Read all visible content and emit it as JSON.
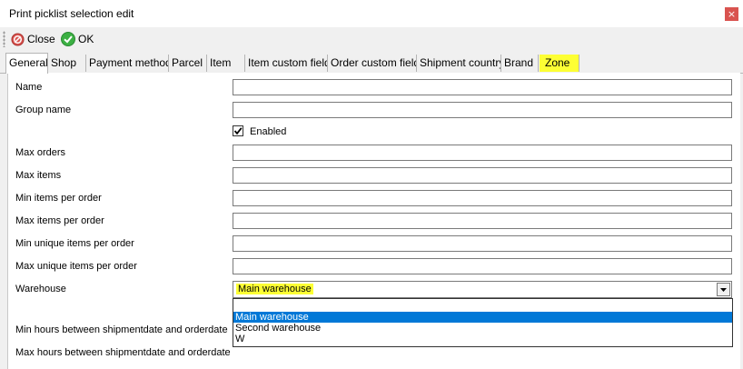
{
  "window": {
    "title": "Print picklist selection edit",
    "close_glyph": "×"
  },
  "toolbar": {
    "close_label": "Close",
    "ok_label": "OK"
  },
  "tabs": [
    {
      "id": "general",
      "label": "General",
      "active": true
    },
    {
      "id": "shop",
      "label": "Shop"
    },
    {
      "id": "payment-method",
      "label": "Payment method"
    },
    {
      "id": "parcel",
      "label": "Parcel"
    },
    {
      "id": "item",
      "label": "Item"
    },
    {
      "id": "item-custom-field",
      "label": "Item custom field"
    },
    {
      "id": "order-custom-field",
      "label": "Order custom field"
    },
    {
      "id": "shipment-country",
      "label": "Shipment country"
    },
    {
      "id": "brand",
      "label": "Brand"
    },
    {
      "id": "zone",
      "label": "Zone",
      "highlighted": true
    }
  ],
  "form": {
    "name_label": "Name",
    "name_value": "",
    "group_name_label": "Group name",
    "group_name_value": "",
    "enabled_label": "Enabled",
    "enabled_checked": true,
    "max_orders_label": "Max orders",
    "max_orders_value": "",
    "max_items_label": "Max items",
    "max_items_value": "",
    "min_items_per_order_label": "Min items per order",
    "min_items_per_order_value": "",
    "max_items_per_order_label": "Max items per order",
    "max_items_per_order_value": "",
    "min_unique_items_per_order_label": "Min unique items per order",
    "min_unique_items_per_order_value": "",
    "max_unique_items_per_order_label": "Max unique items per order",
    "max_unique_items_per_order_value": "",
    "warehouse_label": "Warehouse",
    "warehouse_value": "Main warehouse",
    "warehouse_options": [
      "",
      "Main warehouse",
      "Second warehouse",
      "W"
    ],
    "warehouse_selected_option": "Main warehouse",
    "min_hours_label": "Min hours between shipmentdate and orderdate",
    "max_hours_label": "Max hours between shipmentdate and orderdate"
  },
  "colors": {
    "highlight": "#fdff34",
    "selection": "#0078d7",
    "close_button": "#d9534f",
    "ok_icon": "#3cb043",
    "close_icon": "#d9534f"
  }
}
